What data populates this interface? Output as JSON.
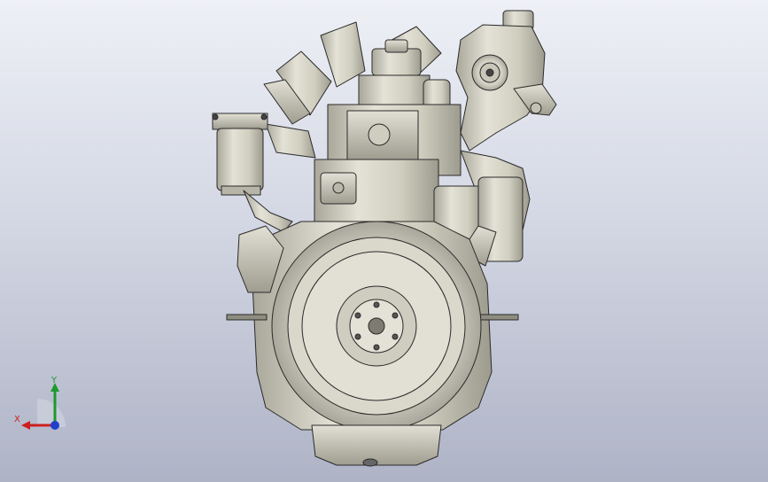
{
  "viewport": {
    "background_top": "#eef0f6",
    "background_bottom": "#aeb3c6"
  },
  "model": {
    "icon": "engine-assembly-icon",
    "body_color": "#d8d6c8",
    "shade_color": "#a8a699",
    "edge_color": "#2a2a2a"
  },
  "triad": {
    "x_label": "X",
    "y_label": "Y",
    "x_color": "#cc1f1f",
    "y_color": "#1c9a2e",
    "z_color": "#1f3fcc"
  }
}
